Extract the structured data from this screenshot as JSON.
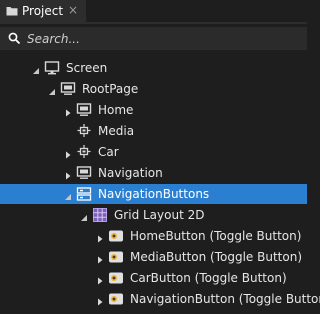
{
  "panel": {
    "tab_label": "Project",
    "tab_close": "×",
    "search_placeholder": "Search..."
  },
  "tree": [
    {
      "label": "Screen",
      "icon": "monitor-icon",
      "arrow": "expanded"
    },
    {
      "label": "RootPage",
      "icon": "page-icon",
      "arrow": "expanded"
    },
    {
      "label": "Home",
      "icon": "page-icon",
      "arrow": "collapsed"
    },
    {
      "label": "Media",
      "icon": "prefab-icon",
      "arrow": "none"
    },
    {
      "label": "Car",
      "icon": "prefab-icon",
      "arrow": "collapsed"
    },
    {
      "label": "Navigation",
      "icon": "page-icon",
      "arrow": "collapsed"
    },
    {
      "label": "NavigationButtons",
      "icon": "prefab-instance-icon",
      "arrow": "expanded",
      "selected": true
    },
    {
      "label": "Grid Layout 2D",
      "icon": "grid-layout-icon",
      "arrow": "expanded"
    },
    {
      "label": "HomeButton (Toggle Button)",
      "icon": "toggle-button-icon",
      "arrow": "collapsed"
    },
    {
      "label": "MediaButton (Toggle Button)",
      "icon": "toggle-button-icon",
      "arrow": "collapsed"
    },
    {
      "label": "CarButton (Toggle Button)",
      "icon": "toggle-button-icon",
      "arrow": "collapsed"
    },
    {
      "label": "NavigationButton (Toggle Button)",
      "icon": "toggle-button-icon",
      "arrow": "collapsed"
    }
  ],
  "colors": {
    "selection": "#2b7fd1",
    "background": "#1e1e1e",
    "toggle_icon_accent": "#f0b030",
    "grid_icon": "#9b7fd4"
  }
}
